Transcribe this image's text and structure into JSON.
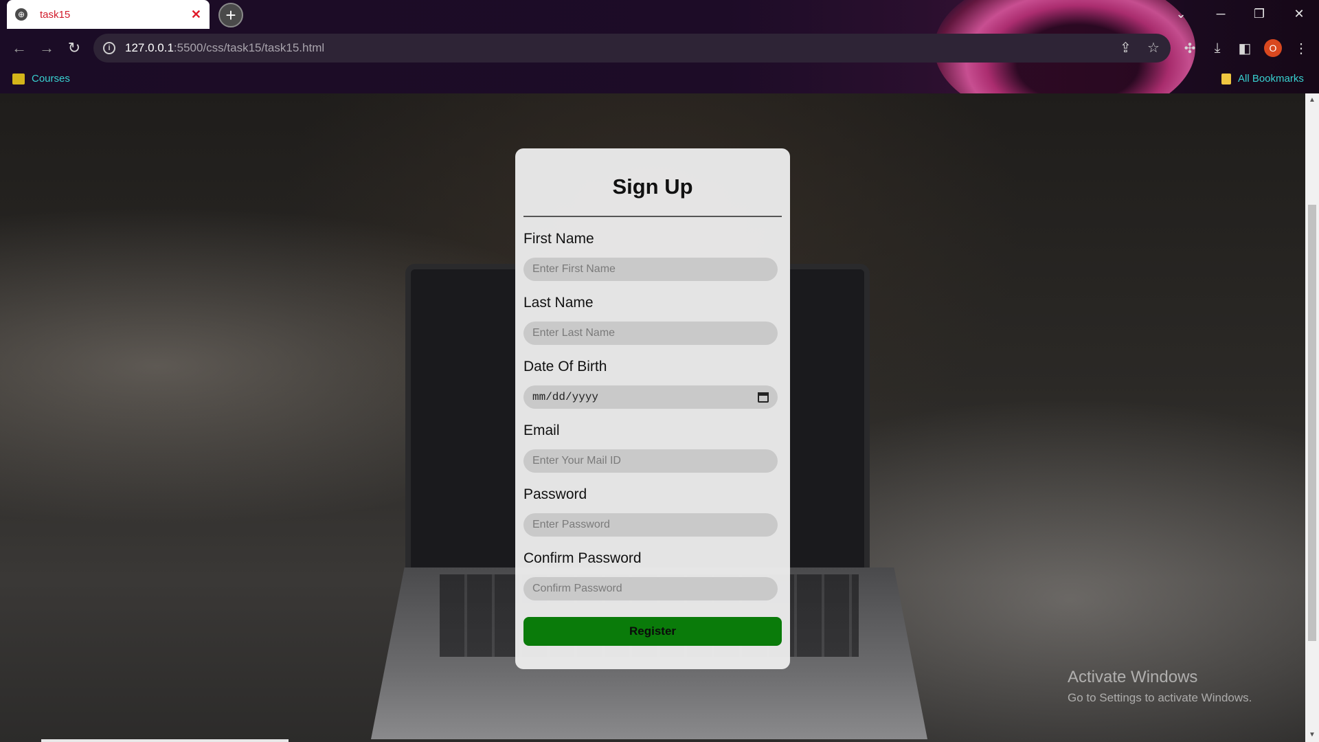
{
  "browser": {
    "tab": {
      "title": "task15"
    },
    "url": {
      "host": "127.0.0.1",
      "path": ":5500/css/task15/task15.html"
    },
    "bookmarks": {
      "courses": "Courses",
      "all": "All Bookmarks"
    },
    "profile_initial": "O"
  },
  "form": {
    "title": "Sign Up",
    "fields": [
      {
        "label": "First Name",
        "placeholder": "Enter First Name"
      },
      {
        "label": "Last Name",
        "placeholder": "Enter Last Name"
      },
      {
        "label": "Date Of Birth",
        "placeholder": "mm/dd/yyyy"
      },
      {
        "label": "Email",
        "placeholder": "Enter Your Mail ID"
      },
      {
        "label": "Password",
        "placeholder": "Enter Password"
      },
      {
        "label": "Confirm Password",
        "placeholder": "Confirm Password"
      }
    ],
    "submit_label": "Register"
  },
  "watermark": {
    "title": "Activate Windows",
    "subtitle": "Go to Settings to activate Windows."
  },
  "colors": {
    "register_button": "#0a7b0a",
    "bookmark_text": "#38d1d1",
    "tab_title": "#d11a2a"
  }
}
